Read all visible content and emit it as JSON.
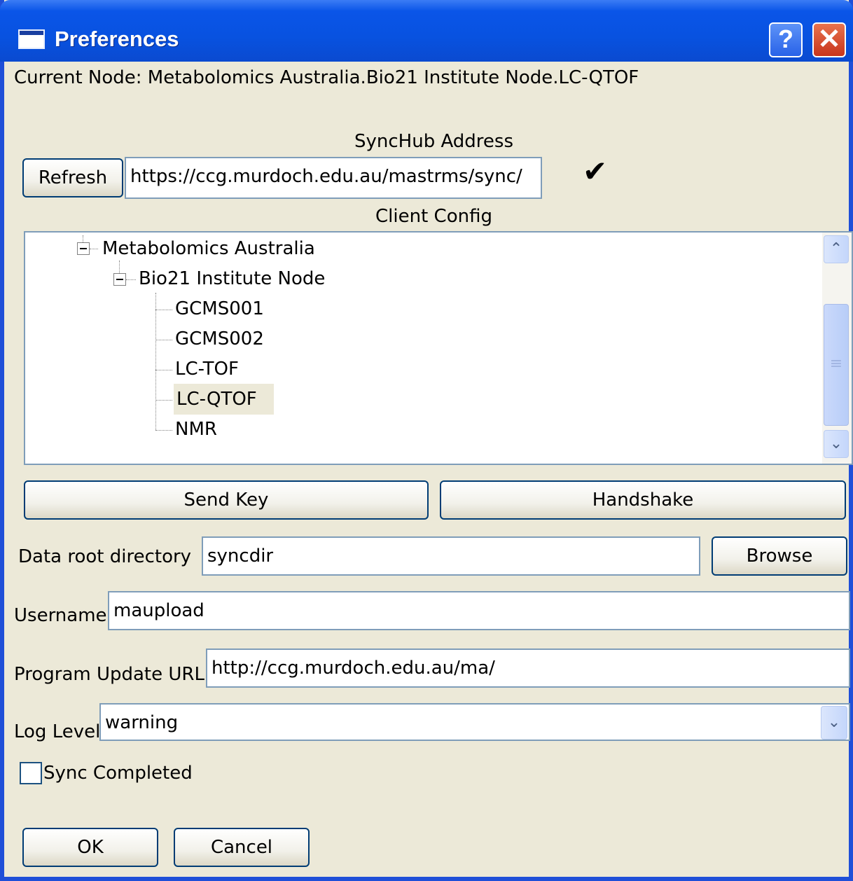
{
  "window": {
    "title": "Preferences",
    "help_glyph": "?",
    "close_glyph": "✕"
  },
  "current_node": {
    "text": "Current Node: Metabolomics Australia.Bio21 Institute Node.LC-QTOF"
  },
  "synchub": {
    "heading": "SyncHub Address",
    "refresh_label": "Refresh",
    "address_value": "https://ccg.murdoch.edu.au/mastrms/sync/",
    "status_icon": "checkmark-icon",
    "status_glyph": "✔"
  },
  "client_config": {
    "heading": "Client Config",
    "tree": {
      "root": "Metabolomics Australia",
      "node": "Bio21 Institute Node",
      "leaves": [
        "GCMS001",
        "GCMS002",
        "LC-TOF",
        "LC-QTOF",
        "NMR"
      ],
      "selected": "LC-QTOF"
    },
    "scroll_up_glyph": "⌃",
    "scroll_down_glyph": "⌄",
    "scroll_grip_glyph": "≡"
  },
  "actions": {
    "send_key_label": "Send Key",
    "handshake_label": "Handshake"
  },
  "fields": {
    "data_root_label": "Data root directory",
    "data_root_value": "syncdir",
    "browse_label": "Browse",
    "username_label": "Username",
    "username_value": "maupload",
    "update_url_label": "Program Update URL",
    "update_url_value": "http://ccg.murdoch.edu.au/ma/",
    "log_level_label": "Log Level",
    "log_level_value": "warning",
    "log_level_arrow": "⌄",
    "sync_completed_label": "Sync Completed",
    "sync_completed_checked": false
  },
  "footer": {
    "ok_label": "OK",
    "cancel_label": "Cancel"
  },
  "colors": {
    "title_blue": "#0852e0",
    "dialog_bg": "#ece9d8",
    "field_border": "#7f9db9",
    "close_red": "#c8351c"
  }
}
